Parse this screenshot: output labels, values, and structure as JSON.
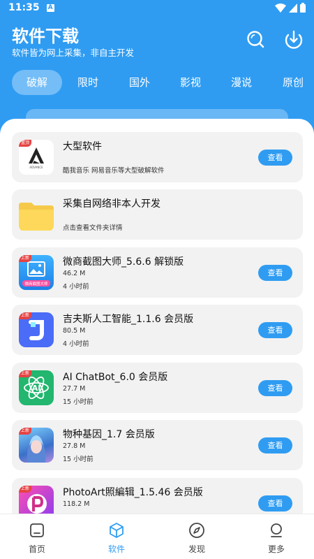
{
  "status": {
    "time": "11:35",
    "notif_letter": "A"
  },
  "header": {
    "title": "软件下载",
    "subtitle": "软件皆为网上采集，非自主开发"
  },
  "tabs": [
    {
      "label": "破解",
      "active": true
    },
    {
      "label": "限时"
    },
    {
      "label": "国外"
    },
    {
      "label": "影视"
    },
    {
      "label": "漫说"
    },
    {
      "label": "原创"
    }
  ],
  "items": [
    {
      "title": "大型软件",
      "line1": "酷我音乐 网易音乐等大型破解软件",
      "line2": "",
      "tag": "置顶",
      "button": "查看"
    },
    {
      "title": "采集自网络非本人开发",
      "line1": "点击查看文件夹详情",
      "line2": "",
      "tag": "",
      "button": ""
    },
    {
      "title": "微商截图大师_5.6.6 解锁版",
      "line1": "46.2 M",
      "line2": "4 小时前",
      "tag": "上新",
      "button": "查看"
    },
    {
      "title": "吉夫斯人工智能_1.1.6 会员版",
      "line1": "80.5 M",
      "line2": "4 小时前",
      "tag": "上新",
      "button": "查看"
    },
    {
      "title": "AI ChatBot_6.0 会员版",
      "line1": "27.7 M",
      "line2": "15 小时前",
      "tag": "上新",
      "button": "查看"
    },
    {
      "title": "物种基因_1.7 会员版",
      "line1": "27.8 M",
      "line2": "15 小时前",
      "tag": "上新",
      "button": "查看"
    },
    {
      "title": "PhotoArt照編辑_1.5.46 会员版",
      "line1": "118.2 M",
      "line2": "",
      "tag": "上新",
      "button": "查看"
    }
  ],
  "icon_texts": {
    "weishang": "微商截图大师",
    "ai": "AI",
    "adv": "ADVANCE"
  },
  "nav": [
    {
      "label": "首页",
      "icon": "home-icon"
    },
    {
      "label": "软件",
      "icon": "box-icon",
      "active": true
    },
    {
      "label": "发现",
      "icon": "compass-icon"
    },
    {
      "label": "更多",
      "icon": "user-icon"
    }
  ],
  "colors": {
    "primary": "#2f9cf2",
    "card_bg": "#f2f2f2",
    "tag_red": "#e64343"
  }
}
